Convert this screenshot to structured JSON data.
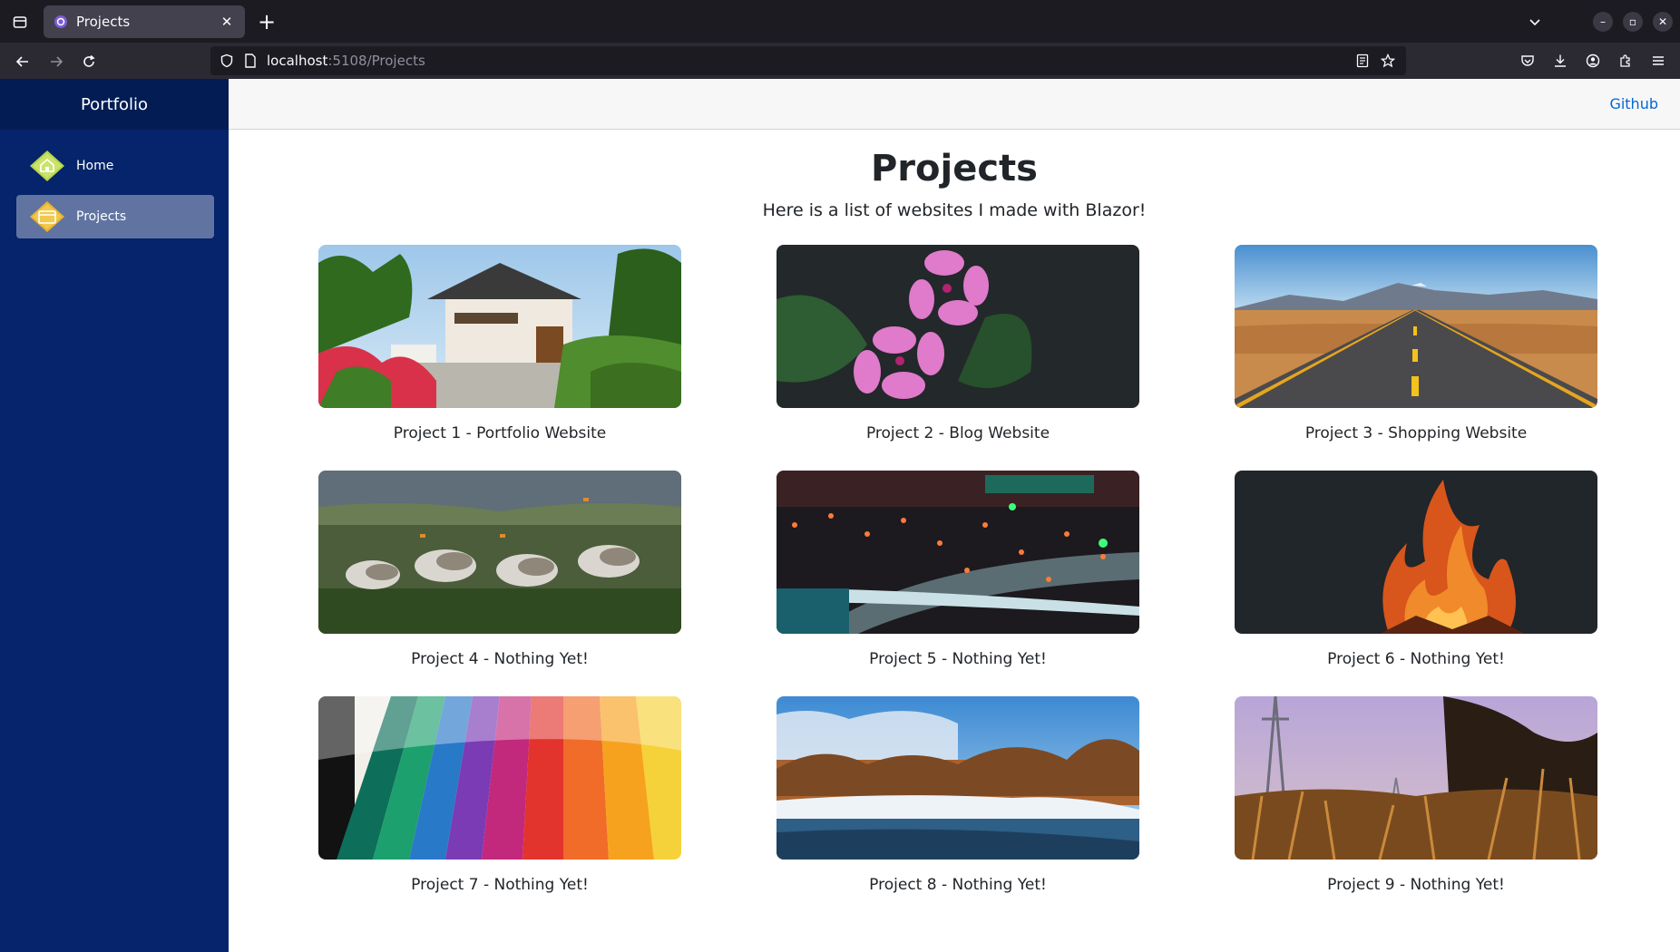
{
  "browser": {
    "tab_title": "Projects",
    "url_host": "localhost",
    "url_rest": ":5108/Projects"
  },
  "sidebar": {
    "brand": "Portfolio",
    "items": [
      {
        "label": "Home",
        "icon": "home-icon",
        "active": false
      },
      {
        "label": "Projects",
        "icon": "projects-icon",
        "active": true
      }
    ]
  },
  "topbar": {
    "github_label": "Github"
  },
  "main": {
    "title": "Projects",
    "subtitle": "Here is a list of websites I made with Blazor!",
    "projects": [
      {
        "caption": "Project 1 - Portfolio Website",
        "image": "japanese-house-photo"
      },
      {
        "caption": "Project 2 - Blog Website",
        "image": "pink-flowers-photo"
      },
      {
        "caption": "Project 3 - Shopping Website",
        "image": "desert-road-photo"
      },
      {
        "caption": "Project 4 - Nothing Yet!",
        "image": "geese-photo"
      },
      {
        "caption": "Project 5 - Nothing Yet!",
        "image": "city-night-photo"
      },
      {
        "caption": "Project 6 - Nothing Yet!",
        "image": "fire-photo"
      },
      {
        "caption": "Project 7 - Nothing Yet!",
        "image": "color-swatches-photo"
      },
      {
        "caption": "Project 8 - Nothing Yet!",
        "image": "winter-river-photo"
      },
      {
        "caption": "Project 9 - Nothing Yet!",
        "image": "power-tower-grass-photo"
      }
    ]
  },
  "colors": {
    "sidebar": "#05246b",
    "brand_bar": "#031d54",
    "link": "#0366d6",
    "chrome_dark": "#1c1b22",
    "chrome_mid": "#2b2a33"
  }
}
